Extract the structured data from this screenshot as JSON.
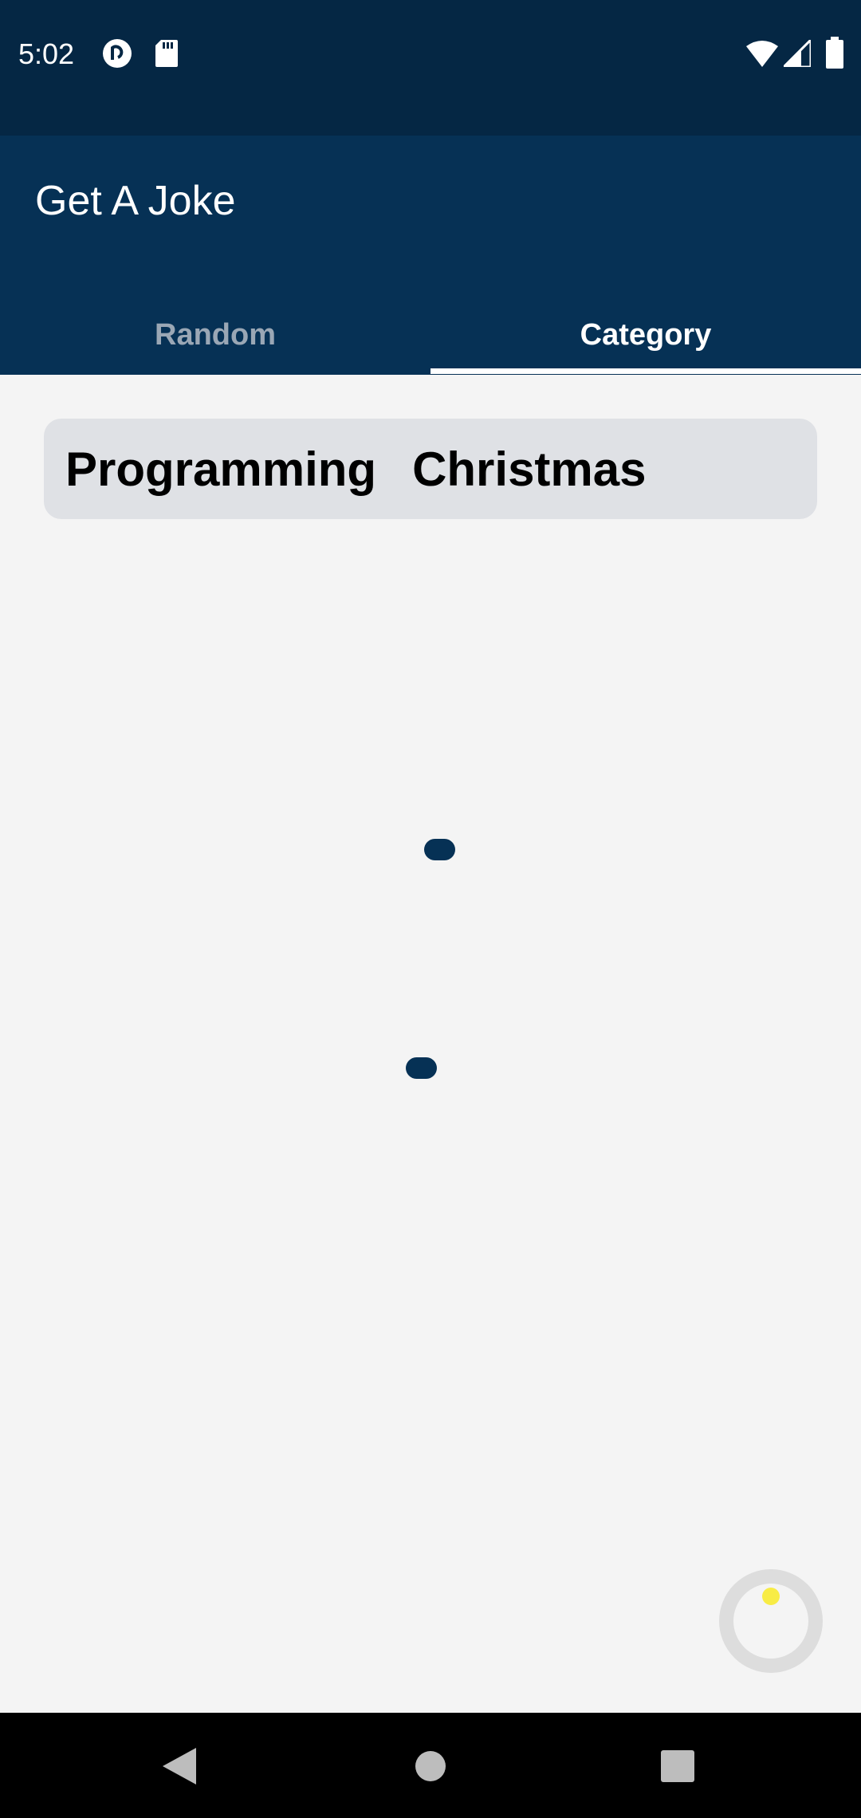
{
  "status_bar": {
    "time": "5:02",
    "icons": [
      "pocket-casts-icon",
      "sd-card-icon",
      "wifi-icon",
      "signal-icon",
      "battery-icon"
    ]
  },
  "app_bar": {
    "title": "Get A Joke",
    "tabs": [
      {
        "label": "Random",
        "selected": false
      },
      {
        "label": "Category",
        "selected": true
      }
    ]
  },
  "categories": {
    "items": [
      "Programming",
      "Christmas"
    ]
  },
  "navigation": {
    "buttons": [
      "back-icon",
      "home-icon",
      "recents-icon"
    ]
  },
  "colors": {
    "status_bar": "#052744",
    "app_bar": "#063155",
    "background": "#f4f4f4",
    "category_bar": "#dfe1e5",
    "accent_dot": "#063155",
    "fab_dot": "#f8ec45"
  }
}
